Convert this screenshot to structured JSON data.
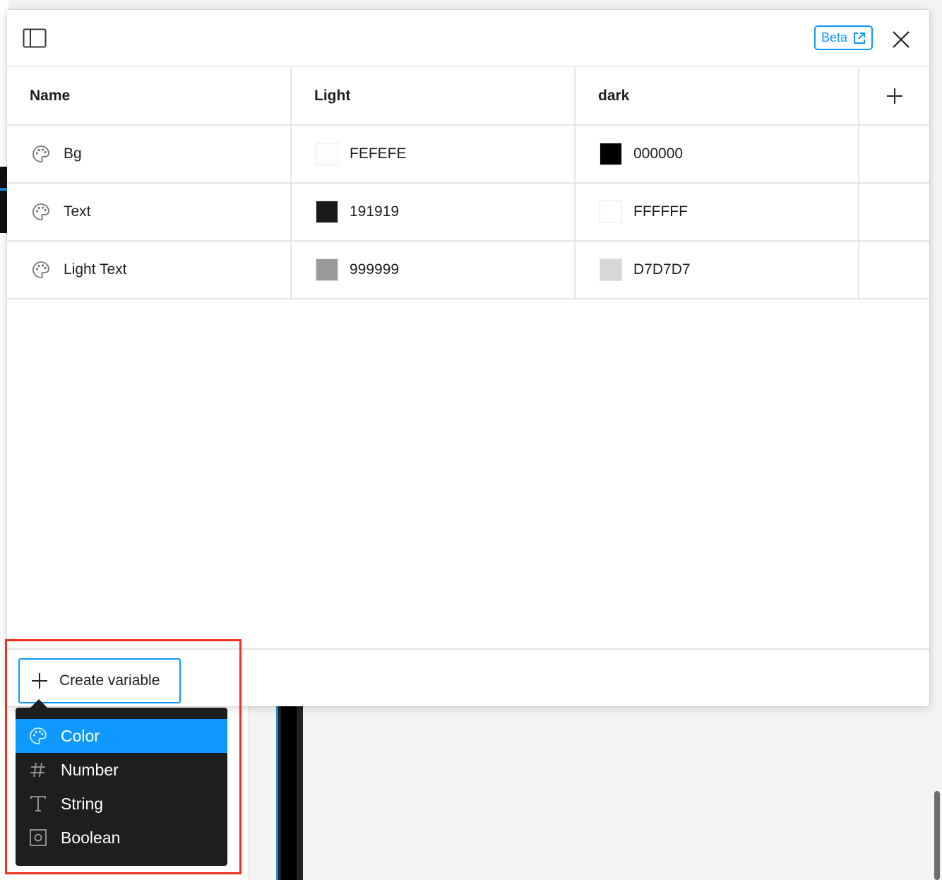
{
  "header": {
    "beta_label": "Beta"
  },
  "table": {
    "columns": [
      {
        "label": "Name"
      },
      {
        "label": "Light"
      },
      {
        "label": "dark"
      }
    ],
    "rows": [
      {
        "name": "Bg",
        "light": "FEFEFE",
        "light_color": "#FEFEFE",
        "dark": "000000",
        "dark_color": "#000000"
      },
      {
        "name": "Text",
        "light": "191919",
        "light_color": "#191919",
        "dark": "FFFFFF",
        "dark_color": "#FFFFFF"
      },
      {
        "name": "Light Text",
        "light": "999999",
        "light_color": "#999999",
        "dark": "D7D7D7",
        "dark_color": "#D7D7D7"
      }
    ]
  },
  "footer": {
    "create_label": "Create variable"
  },
  "type_menu": {
    "items": [
      {
        "label": "Color",
        "icon": "palette-icon",
        "selected": true
      },
      {
        "label": "Number",
        "icon": "hash-icon",
        "selected": false
      },
      {
        "label": "String",
        "icon": "text-t-icon",
        "selected": false
      },
      {
        "label": "Boolean",
        "icon": "boolean-icon",
        "selected": false
      }
    ]
  },
  "colors": {
    "accent": "#0d99ff",
    "highlight": "#f2301a",
    "menu_bg": "#1e1e1e"
  }
}
